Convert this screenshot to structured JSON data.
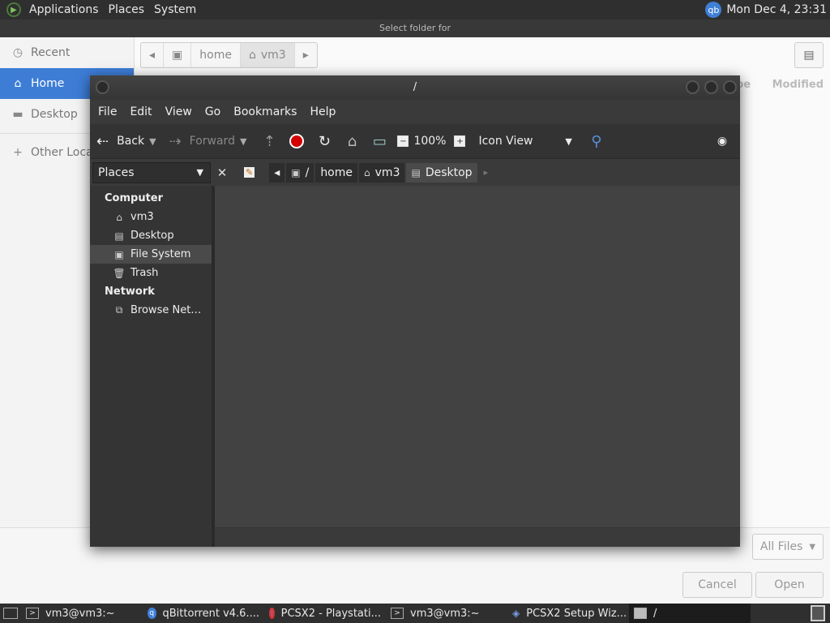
{
  "top_panel": {
    "menus": [
      "Applications",
      "Places",
      "System"
    ],
    "tray_badge": "qb",
    "clock": "Mon Dec  4, 23:31"
  },
  "gtk_dialog": {
    "title": "Select folder for",
    "sidebar": [
      {
        "label": "Recent",
        "icon": "clock-icon"
      },
      {
        "label": "Home",
        "icon": "home-icon",
        "active": true
      },
      {
        "label": "Desktop",
        "icon": "folder-icon"
      },
      {
        "label": "Other Locat",
        "icon": "plus-icon"
      }
    ],
    "pathbar": [
      "home",
      "vm3"
    ],
    "columns": [
      "Type",
      "Modified"
    ],
    "filter": "All Files",
    "cancel": "Cancel",
    "open": "Open"
  },
  "caja": {
    "title": "/",
    "menus": [
      "File",
      "Edit",
      "View",
      "Go",
      "Bookmarks",
      "Help"
    ],
    "toolbar": {
      "back": "Back",
      "forward": "Forward",
      "zoom": "100%",
      "view_mode": "Icon View"
    },
    "places_select": "Places",
    "breadcrumbs": [
      "/",
      "home",
      "vm3",
      "Desktop"
    ],
    "sidebar": {
      "computer_header": "Computer",
      "computer_items": [
        "vm3",
        "Desktop",
        "File System",
        "Trash"
      ],
      "network_header": "Network",
      "network_items": [
        "Browse Net…"
      ]
    }
  },
  "taskbar": {
    "tasks": [
      {
        "label": "vm3@vm3:~",
        "icon": "terminal-icon"
      },
      {
        "label": "qBittorrent v4.6....",
        "icon": "qbittorrent-icon"
      },
      {
        "label": "PCSX2 - Playstati...",
        "icon": "chrome-icon"
      },
      {
        "label": "vm3@vm3:~",
        "icon": "terminal-icon"
      },
      {
        "label": "PCSX2 Setup Wiz...",
        "icon": "pcsx2-icon"
      },
      {
        "label": "/",
        "icon": "folder-icon",
        "active": true
      }
    ]
  }
}
